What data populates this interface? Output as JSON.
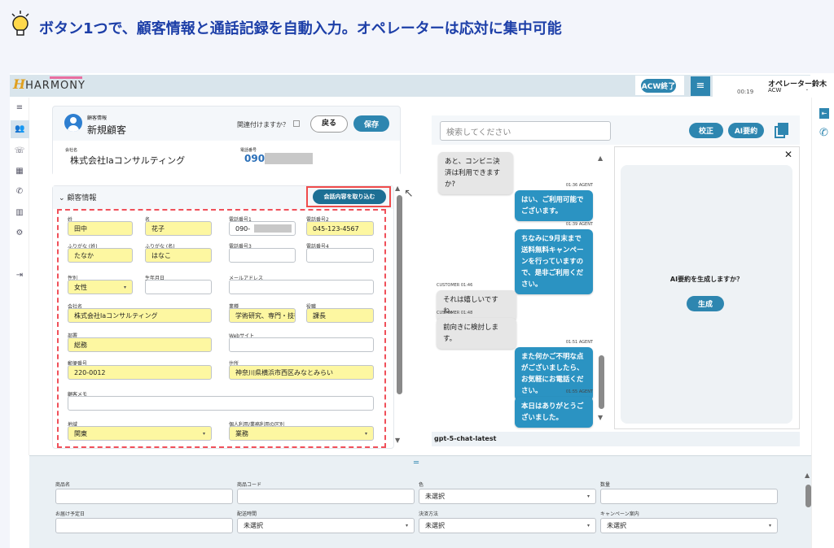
{
  "caption": {
    "icon": "lightbulb-icon",
    "text": "ボタン1つで、顧客情報と通話記録を自動入力。オペレーターは応対に集中可能"
  },
  "header": {
    "logo": "HARMONY",
    "acw_end": "ACW終了",
    "operator": "オペレーター鈴木",
    "timer": "00:19",
    "status": "ACW"
  },
  "sidebar": {
    "icons": [
      "menu-icon",
      "customers-icon",
      "call-history-icon",
      "apps-icon",
      "phone-icon",
      "chart-icon",
      "gear-icon",
      "logout-icon"
    ]
  },
  "customer_card": {
    "subtitle": "顧客情報",
    "title": "新規顧客",
    "link_question": "関連付けますか？",
    "back": "戻る",
    "save": "保存",
    "company_label": "会社名",
    "company": "株式会社laコンサルティング",
    "phone_label": "電話番号",
    "phone": "090-"
  },
  "section": {
    "title": "顧客情報",
    "import_button": "会話内容を取り込む"
  },
  "form": [
    {
      "label": "姓",
      "value": "田中",
      "filled": true
    },
    {
      "label": "名",
      "value": "花子",
      "filled": true
    },
    {
      "label": "電話番号1",
      "value": "090-",
      "filled": false
    },
    {
      "label": "電話番号2",
      "value": "045-123-4567",
      "filled": true
    },
    {
      "label": "ふりがな (姓)",
      "value": "たなか",
      "filled": true
    },
    {
      "label": "ふりがな (名)",
      "value": "はなこ",
      "filled": true
    },
    {
      "label": "電話番号3",
      "value": "",
      "filled": false
    },
    {
      "label": "電話番号4",
      "value": "",
      "filled": false
    },
    {
      "label": "性別",
      "value": "女性",
      "filled": true,
      "select": true
    },
    {
      "label": "生年月日",
      "value": "",
      "filled": false
    },
    {
      "label": "メールアドレス",
      "value": "",
      "filled": false
    },
    {
      "label": "会社名",
      "value": "株式会社laコンサルティング",
      "filled": true
    },
    {
      "label": "業種",
      "value": "学術研究、専門・技術",
      "filled": true
    },
    {
      "label": "役職",
      "value": "課長",
      "filled": true
    },
    {
      "label": "部署",
      "value": "総務",
      "filled": true
    },
    {
      "label": "Webサイト",
      "value": "",
      "filled": false
    },
    {
      "label": "郵便番号",
      "value": "220-0012",
      "filled": true
    },
    {
      "label": "住所",
      "value": "神奈川県横浜市西区みなとみらい",
      "filled": true
    },
    {
      "label": "顧客メモ",
      "value": "",
      "filled": false
    },
    {
      "label": "地域",
      "value": "関東",
      "filled": true,
      "select": true
    },
    {
      "label": "個人利用/業務利用の区別",
      "value": "業務",
      "filled": true,
      "select": true
    }
  ],
  "chat": {
    "search_placeholder": "検索してください",
    "proofread": "校正",
    "ai_summary": "AI要約",
    "model": "gpt-5-chat-latest",
    "messages": [
      {
        "role": "customer",
        "meta": "",
        "text": "あと、コンビニ決済は利用できますか?"
      },
      {
        "role": "agent",
        "meta": "01:36  AGENT",
        "text": "はい、ご利用可能でございます。"
      },
      {
        "role": "agent",
        "meta": "01:39  AGENT",
        "text": "ちなみに9月末まで送料無料キャンペーンを行っていますので、是非ご利用ください。"
      },
      {
        "role": "customer",
        "meta": "CUSTOMER  01:46",
        "text": "それは嬉しいですね。"
      },
      {
        "role": "customer",
        "meta": "CUSTOMER  01:48",
        "text": "前向きに検討します。"
      },
      {
        "role": "agent",
        "meta": "01:51  AGENT",
        "text": "また何かご不明な点がございましたら、お気軽にお電話ください。"
      },
      {
        "role": "agent",
        "meta": "01:55  AGENT",
        "text": "本日はありがとうございました。"
      }
    ]
  },
  "ai_panel": {
    "question": "AI要約を生成しますか？",
    "generate": "生成"
  },
  "order_form": [
    {
      "label": "商品名",
      "value": ""
    },
    {
      "label": "商品コード",
      "value": ""
    },
    {
      "label": "色",
      "value": "未選択",
      "select": true
    },
    {
      "label": "数量",
      "value": ""
    },
    {
      "label": "お届け予定日",
      "value": ""
    },
    {
      "label": "配送時間",
      "value": "未選択",
      "select": true
    },
    {
      "label": "決済方法",
      "value": "未選択",
      "select": true
    },
    {
      "label": "キャンペーン案内",
      "value": "未選択",
      "select": true
    }
  ],
  "colors": {
    "accent": "#2e86b0",
    "highlight": "#fdf7a1",
    "dashed_border": "#f0505a",
    "caption": "#1d3fa8"
  }
}
